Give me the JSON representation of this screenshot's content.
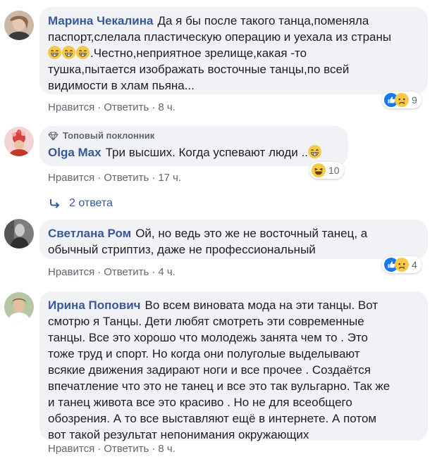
{
  "comments": [
    {
      "author": "Марина Чекалина",
      "lines": [
        "Да я бы после такого танца,поменяла",
        "паспорт,слелала пластическую операцию и уехала из страны",
        ".Честно,неприятное зрелище,какая -то",
        "тушка,пытается изображать восточные танцы,по всей",
        "видимости в хлам пьяна..."
      ],
      "like": "Нравится",
      "reply": "Ответить",
      "time": "8 ч.",
      "reaction_count": "9"
    },
    {
      "badge": "Топовый поклонник",
      "author": "Olga Max",
      "text": "Три высших. Когда успевают люди ..",
      "like": "Нравится",
      "reply": "Ответить",
      "time": "17 ч.",
      "reaction_count": "10"
    },
    {
      "author": "Светлана Ром",
      "lines": [
        "Ой, но ведь это же не восточный танец, а",
        "обычный стриптиз, даже не профессиональный"
      ],
      "like": "Нравится",
      "reply": "Ответить",
      "time": "4 ч.",
      "reaction_count": "4"
    },
    {
      "author": "Ирина Попович",
      "lines": [
        "Во всем виновата мода на эти танцы. Вот",
        "смотрю я Танцы. Дети любят смотреть эти современные",
        "танцы. Все это хорошо что молодежь занята чем то . Это",
        "тоже труд и спорт. Но когда они полуголые выделывают",
        "всякие движения задирают ноги и все прочее . Создаётся",
        "впечатление что это не танец и все это так вульгарно. Так же",
        "и танец живота все это красиво . Но не для всеобщего",
        "обозрения. А то все выставляют ещё в интернете. А потом",
        "вот такой результат непонимания окружающих"
      ],
      "like": "Нравится",
      "reply": "Ответить",
      "time": "8 ч."
    }
  ],
  "replies_link": "2 ответа",
  "icons": {
    "like": "like-icon",
    "sad": "sad-icon",
    "haha": "haha-icon",
    "grin": "grin-emoji-icon",
    "diamond": "diamond-icon",
    "reply_arrow": "reply-arrow-icon"
  },
  "colors": {
    "link": "#385898",
    "bubble": "#f0f2f5",
    "meta": "#606770",
    "like_blue": "#1877f2",
    "emoji_yellow": "#f7c948"
  }
}
